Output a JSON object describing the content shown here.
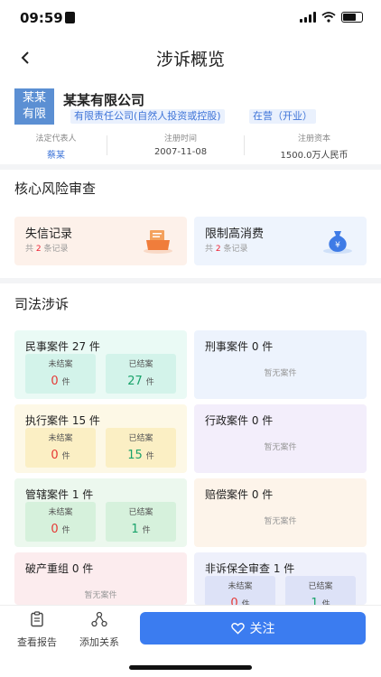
{
  "status": {
    "time": "09:59"
  },
  "nav": {
    "title": "涉诉概览",
    "back_icon": "chevron-left-icon"
  },
  "company": {
    "logo_line1": "某某",
    "logo_line2": "有限",
    "name": "某某有限公司",
    "tags": [
      "有限责任公司(自然人投资或控股)",
      "在营（开业）"
    ],
    "info": [
      {
        "label": "法定代表人",
        "value": "蔡某"
      },
      {
        "label": "注册时间",
        "value": "2007-11-08"
      },
      {
        "label": "注册资本",
        "value": "1500.0万人民币"
      }
    ]
  },
  "risk": {
    "title": "核心风险审查",
    "cards": [
      {
        "title": "失信记录",
        "prefix": "共",
        "count": "2",
        "suffix": "条记录",
        "icon": "document-tray-icon",
        "color": "#fdf1ea"
      },
      {
        "title": "限制高消费",
        "prefix": "共",
        "count": "2",
        "suffix": "条记录",
        "icon": "money-bag-icon",
        "color": "#eef4fd"
      }
    ]
  },
  "judicial": {
    "title": "司法涉诉",
    "unfinished_label": "未结案",
    "finished_label": "已结案",
    "unit": "件",
    "empty_text": "暂无案件",
    "cases": [
      {
        "title": "民事案件 27 件",
        "unfinished": "0",
        "finished": "27"
      },
      {
        "title": "刑事案件 0 件"
      },
      {
        "title": "执行案件 15 件",
        "unfinished": "0",
        "finished": "15"
      },
      {
        "title": "行政案件 0 件"
      },
      {
        "title": "管辖案件 1 件",
        "unfinished": "0",
        "finished": "1"
      },
      {
        "title": "赔偿案件 0 件"
      },
      {
        "title": "破产重组 0 件"
      },
      {
        "title": "非诉保全审查 1 件",
        "unfinished": "0",
        "finished": "1"
      }
    ]
  },
  "bottom": {
    "report_label": "查看报告",
    "relation_label": "添加关系",
    "follow_label": "关注"
  }
}
